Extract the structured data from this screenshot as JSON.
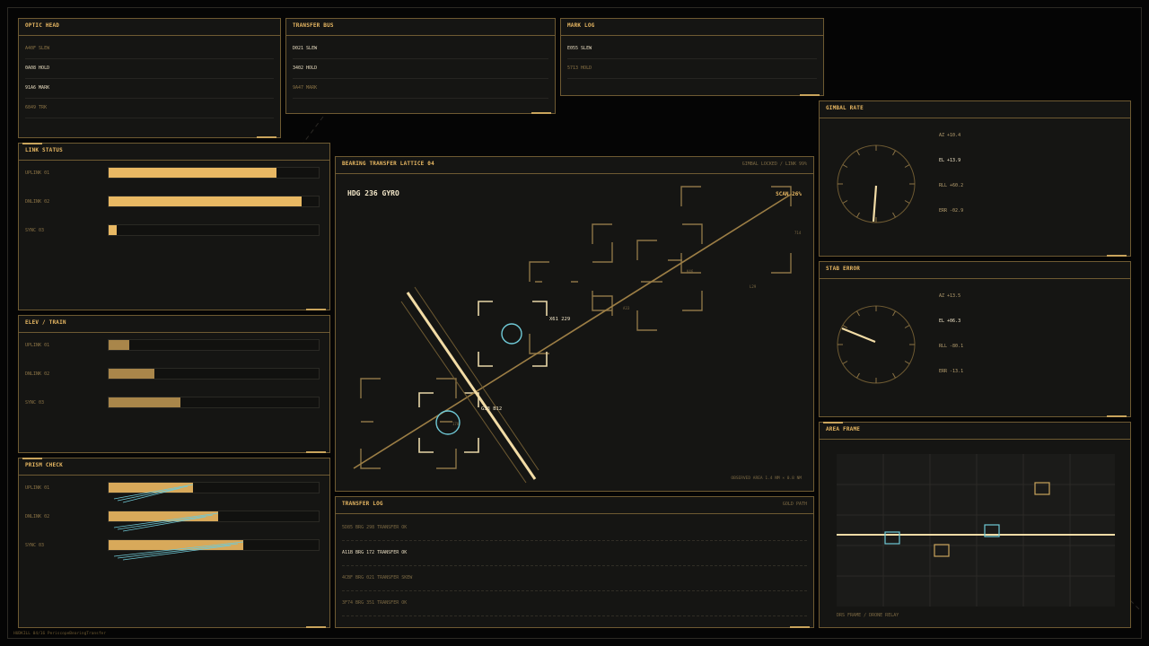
{
  "colors": {
    "accent": "#e8b863",
    "gold_dim": "#8c7446",
    "cyan": "#6fc9d6",
    "bg": "#050505",
    "panel": "#151513"
  },
  "optic_head": {
    "title": "OPTIC HEAD",
    "rows": [
      {
        "text": "A40F SLEW",
        "bright": false
      },
      {
        "text": "0A08 HOLD",
        "bright": true
      },
      {
        "text": "91A6 MARK",
        "bright": true
      },
      {
        "text": "6849 TRK",
        "bright": false
      }
    ]
  },
  "transfer_bus": {
    "title": "TRANSFER BUS",
    "rows": [
      {
        "text": "D021 SLEW",
        "bright": true
      },
      {
        "text": "3402 HOLD",
        "bright": true
      },
      {
        "text": "9A47 MARK",
        "bright": false
      }
    ]
  },
  "mark_log": {
    "title": "MARK LOG",
    "rows": [
      {
        "text": "E055 SLEW",
        "bright": true
      },
      {
        "text": "5713 HOLD",
        "bright": false
      }
    ]
  },
  "link_status": {
    "title": "LINK STATUS",
    "bars": [
      {
        "label": "UPLINK 01",
        "value": 0.8
      },
      {
        "label": "DNLINK 02",
        "value": 0.92
      },
      {
        "label": "SYNC 03",
        "value": 0.04
      }
    ]
  },
  "elev_train": {
    "title": "ELEV / TRAIN",
    "bars": [
      {
        "label": "UPLINK 01",
        "value": 0.1
      },
      {
        "label": "DNLINK 02",
        "value": 0.22
      },
      {
        "label": "SYNC 03",
        "value": 0.34
      }
    ]
  },
  "prism_check": {
    "title": "PRISM CHECK",
    "bars": [
      {
        "label": "UPLINK 01",
        "value": 0.4
      },
      {
        "label": "DNLINK 02",
        "value": 0.52
      },
      {
        "label": "SYNC 03",
        "value": 0.64
      }
    ]
  },
  "lattice": {
    "title": "BEARING TRANSFER LATTICE 04",
    "meta": "GIMBAL LOCKED / LINK 99%",
    "heading": "HDG 236 GYRO",
    "scan": "SCAN 26%",
    "footer": "OBSERVED AREA 1.4 NM × 0.8 NM",
    "marks": {
      "m1": "X61 229",
      "m2": "G33 B12",
      "m3": "714",
      "m4": "K46",
      "m5": "L29",
      "m6": "A33",
      "m7": "170"
    }
  },
  "transfer_log": {
    "title": "TRANSFER LOG",
    "meta": "GOLD PATH",
    "rows": [
      {
        "text": "5D85  BRG 298  TRANSFER OK",
        "bright": false
      },
      {
        "text": "A11B  BRG 172  TRANSFER OK",
        "bright": true
      },
      {
        "text": "4CBF  BRG 021  TRANSFER SKEW",
        "bright": false
      },
      {
        "text": "3F74  BRG 351  TRANSFER OK",
        "bright": false
      }
    ]
  },
  "gimbal_rate": {
    "title": "GIMBAL RATE",
    "readouts": [
      "AZ +10.4",
      "EL +13.9",
      "RLL +60.2",
      "ERR -02.9"
    ],
    "bright_index": 1
  },
  "stab_error": {
    "title": "STAB ERROR",
    "readouts": [
      "AZ +13.5",
      "EL +06.3",
      "RLL -80.1",
      "ERR -13.1"
    ],
    "bright_index": 1
  },
  "area_frame": {
    "title": "AREA FRAME",
    "footer": "DRS FRAME / DRONE RELAY"
  },
  "footer": {
    "label": "HUDKILL 04/16  PeriscopeBearingTransfer"
  }
}
